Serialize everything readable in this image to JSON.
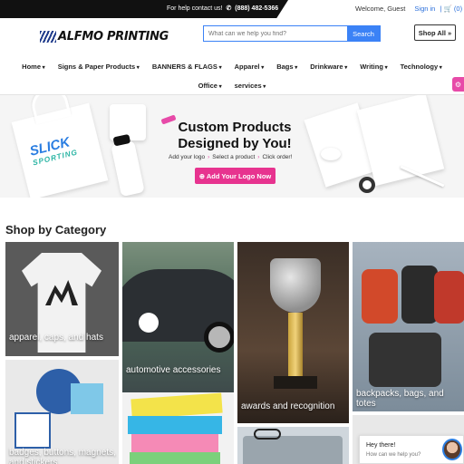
{
  "topbar": {
    "help_label": "For help contact us!",
    "phone": "(888) 482-5366",
    "welcome": "Welcome, Guest",
    "sign_in": "Sign in",
    "cart": "(0)"
  },
  "header": {
    "logo_text": "ALFMO PRINTING",
    "search_placeholder": "What can we help you find?",
    "search_button": "Search",
    "shop_all": "Shop All »"
  },
  "nav": {
    "row1": [
      "Home",
      "Signs & Paper Products",
      "BANNERS & FLAGS",
      "Apparel",
      "Bags",
      "Drinkware",
      "Writing",
      "Technology"
    ],
    "row2": [
      "Office",
      "services"
    ]
  },
  "hero": {
    "title": "Custom Products Designed by You!",
    "steps": [
      "Add your logo",
      "Select a product",
      "Click order!"
    ],
    "cta": "⊕ Add Your Logo Now",
    "brand": "SLICK",
    "brand_sub": "SPORTING"
  },
  "shop": {
    "title": "Shop by Category",
    "categories": [
      "apparel, caps, and hats",
      "automotive accessories",
      "awards and recognition",
      "backpacks, bags, and totes",
      "badges, buttons, magnets, and stickers"
    ]
  },
  "chat": {
    "greeting": "Hey there!",
    "prompt": "How can we help you?"
  },
  "colors": {
    "accent_blue": "#3b82f6",
    "cta_pink": "#e7338f",
    "topbar_black": "#111111"
  }
}
